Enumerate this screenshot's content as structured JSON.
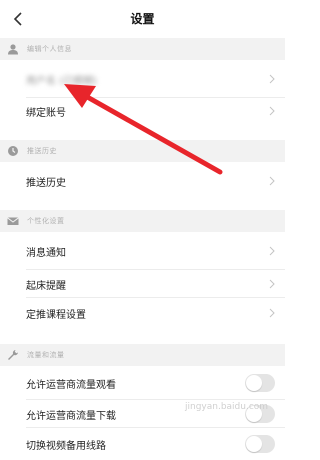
{
  "header": {
    "title": "设置"
  },
  "sections": {
    "profile": {
      "label": "编辑个人信息"
    },
    "history": {
      "label": "推送历史"
    },
    "personalize": {
      "label": "个性化设置"
    },
    "traffic": {
      "label": "流量和流量"
    }
  },
  "rows": {
    "profile_name": "用户名 (已模糊)",
    "bind_account": "绑定账号",
    "push_history": "推送历史",
    "notifications": "消息通知",
    "wake_reminder": "起床提醒",
    "course_push": "定推课程设置",
    "allow_watch": "允许运营商流量观看",
    "allow_download": "允许运营商流量下载",
    "switch_line": "切换视频备用线路"
  },
  "toggles": {
    "allow_watch": false,
    "allow_download": false,
    "switch_line": false
  },
  "colors": {
    "arrow": "#e8252b",
    "section_bg": "#f2f2f2"
  },
  "watermark": "jingyan.baidu.com"
}
